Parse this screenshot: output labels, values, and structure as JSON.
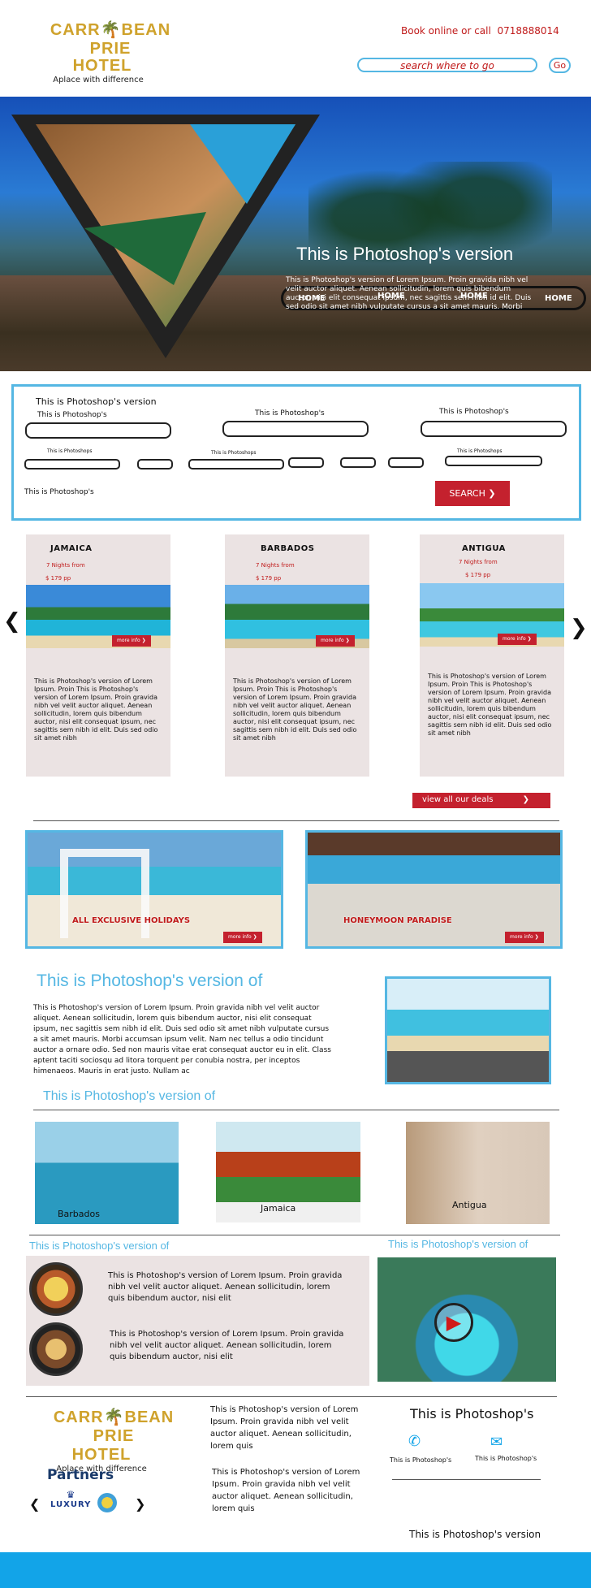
{
  "header": {
    "logo_left": "CARR",
    "logo_right": "BEAN  PRI",
    "logo_end": "E",
    "logo_hotel": "HOTEL",
    "tagline": "Aplace with difference",
    "book_text": "Book online or call",
    "phone": "0718888014",
    "search_placeholder": "search where to go",
    "go_label": "Go"
  },
  "hero": {
    "nav": [
      "HOME",
      "HOME",
      "HOME",
      "HOME"
    ],
    "title": "This is Photoshop's version",
    "text": "This is Photoshop's version  of Lorem Ipsum. Proin gravida nibh vel velit auctor aliquet. Aenean sollicitudin, lorem quis bibendum auctor, nisi elit consequat ipsum, nec sagittis sem nibh id elit. Duis sed odio sit amet nibh vulputate cursus a sit amet mauris. Morbi"
  },
  "search_form": {
    "heading": "This is Photoshop's version",
    "labels": [
      "This is Photoshop's",
      "This is Photoshop's",
      "This is Photoshop's"
    ],
    "small_labels": [
      "This is Photoshops",
      "This is Photoshops",
      "This is Photoshops"
    ],
    "footer_label": "This is Photoshop's",
    "search_button": "SEARCH"
  },
  "deals": [
    {
      "destination": "JAMAICA",
      "nights": "7 Nights from",
      "price": "$ 179 pp",
      "more": "more info",
      "desc": "This is Photoshop's version  of Lorem Ipsum. Proin This is Photoshop's version of Lorem Ipsum. Proin gravida nibh vel velit auctor aliquet. Aenean sollicitudin, lorem quis bibendum auctor, nisi elit consequat ipsum, nec sagittis sem nibh id elit. Duis sed odio sit amet nibh"
    },
    {
      "destination": "BARBADOS",
      "nights": "7 Nights from",
      "price": "$ 179 pp",
      "more": "more info",
      "desc": "This is Photoshop's version  of Lorem Ipsum. Proin This is Photoshop's version of Lorem Ipsum. Proin gravida nibh vel velit auctor aliquet. Aenean sollicitudin, lorem quis bibendum auctor, nisi elit consequat ipsum, nec sagittis sem nibh id elit. Duis sed odio sit amet nibh"
    },
    {
      "destination": "ANTIGUA",
      "nights": "7 Nights from",
      "price": "$ 179 pp",
      "more": "more info",
      "desc": "This is Photoshop's version  of Lorem Ipsum. Proin This is Photoshop's version of Lorem Ipsum. Proin gravida nibh vel velit auctor aliquet. Aenean sollicitudin, lorem quis bibendum auctor, nisi elit consequat ipsum, nec sagittis sem nibh id elit. Duis sed odio sit amet nibh"
    }
  ],
  "view_all": "view all our deals",
  "promos": [
    {
      "caption": "ALL EXCLUSIVE HOLIDAYS",
      "more": "more info"
    },
    {
      "caption": "HONEYMOON PARADISE",
      "more": "more info"
    }
  ],
  "about": {
    "title": "This is Photoshop's version  of",
    "text": "This is Photoshop's version  of Lorem Ipsum. Proin gravida nibh vel velit auctor aliquet. Aenean sollicitudin, lorem quis bibendum auctor, nisi elit consequat ipsum, nec sagittis sem nibh id elit. Duis sed odio sit amet nibh vulputate cursus a sit amet mauris. Morbi accumsan ipsum velit. Nam nec tellus a odio tincidunt auctor a ornare odio. Sed non  mauris vitae erat consequat auctor eu in elit. Class aptent taciti sociosqu ad litora torquent per conubia nostra, per inceptos himenaeos. Mauris in erat justo. Nullam ac"
  },
  "destinations": {
    "title": "This is Photoshop's version  of",
    "items": [
      "Barbados",
      "Jamaica",
      "Antigua"
    ]
  },
  "food": {
    "title": "This is Photoshop's version  of",
    "items": [
      "This is Photoshop's version  of Lorem Ipsum. Proin gravida nibh vel velit auctor aliquet. Aenean sollicitudin, lorem quis bibendum auctor, nisi elit",
      "This is Photoshop's version  of Lorem Ipsum. Proin gravida nibh vel velit auctor aliquet. Aenean sollicitudin, lorem quis bibendum auctor, nisi elit"
    ]
  },
  "video": {
    "title": "This is Photoshop's version  of"
  },
  "footer": {
    "partners": "Partners",
    "partner_logo": "LUXURY",
    "col_text_1": "This is Photoshop's version  of Lorem Ipsum. Proin gravida nibh vel velit auctor aliquet. Aenean sollicitudin, lorem quis",
    "col_text_2": "This is Photoshop's version  of Lorem Ipsum. Proin gravida nibh vel velit auctor aliquet. Aenean sollicitudin, lorem quis",
    "contact_title": "This is Photoshop's",
    "phone_label": "This is Photoshop's",
    "mail_label": "This is Photoshop's",
    "bottom_text": "This is Photoshop's version"
  },
  "colors": {
    "accent": "#55b7e3",
    "brand_red": "#c4212e",
    "gold": "#cfa22c",
    "footer_blue": "#12a4e8"
  }
}
